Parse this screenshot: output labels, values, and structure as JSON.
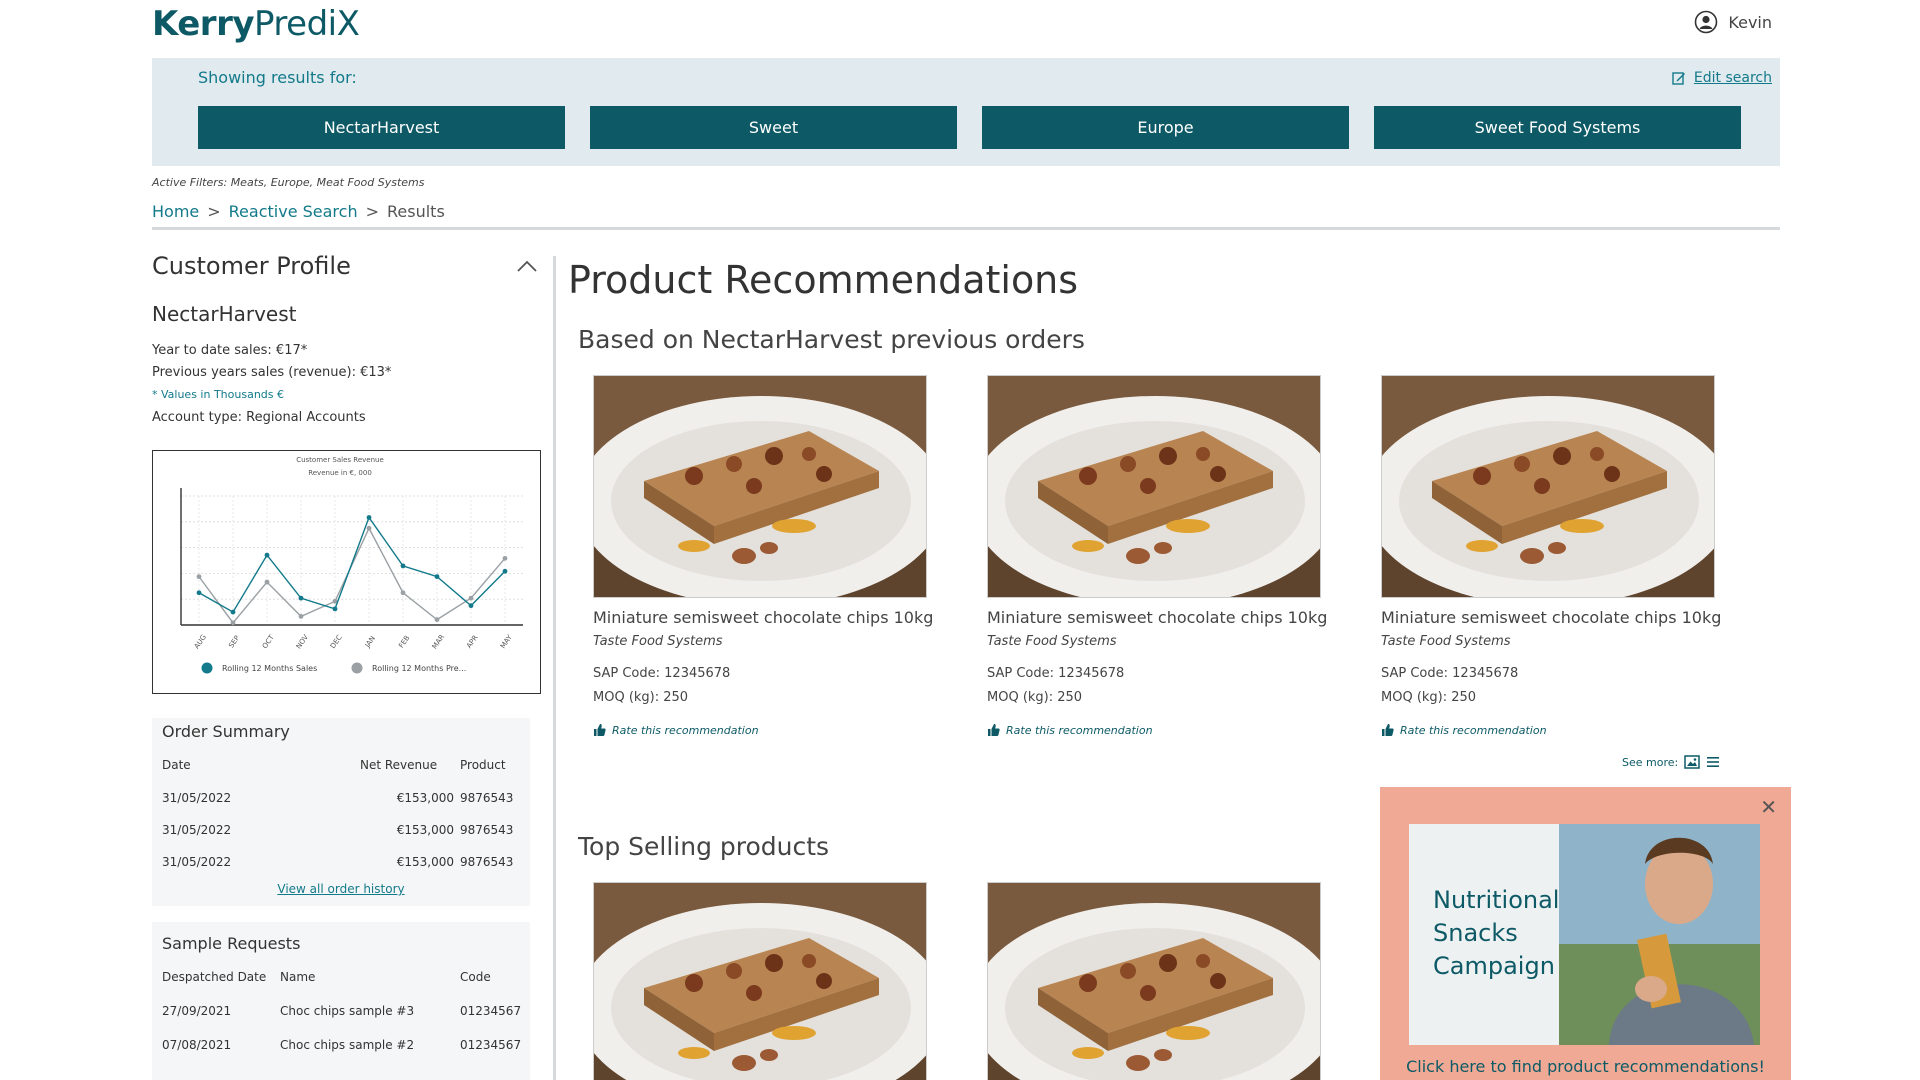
{
  "brand": {
    "bold": "Kerry",
    "light": "PrediX"
  },
  "user": {
    "name": "Kevin"
  },
  "search": {
    "showing_label": "Showing results for:",
    "edit_label": "Edit search",
    "chips": [
      "NectarHarvest",
      "Sweet",
      "Europe",
      "Sweet Food Systems"
    ]
  },
  "filters": "Active Filters: Meats, Europe, Meat Food Systems",
  "breadcrumb": {
    "home": "Home",
    "sep": ">",
    "search": "Reactive Search",
    "current": "Results"
  },
  "profile": {
    "title": "Customer Profile",
    "name": "NectarHarvest",
    "ytd": "Year to date sales: €17*",
    "prev": "Previous years sales (revenue): €13*",
    "note": "* Values in Thousands €",
    "account": "Account type: Regional Accounts"
  },
  "chart_data": {
    "type": "line",
    "title": "Customer Sales Revenue",
    "subtitle": "Revenue in €, 000",
    "categories": [
      "AUG",
      "SEP",
      "OCT",
      "NOV",
      "DEC",
      "JAN",
      "FEB",
      "MAR",
      "APR",
      "MAY"
    ],
    "series": [
      {
        "name": "Rolling 12 Months Sales",
        "color": "#127a8a",
        "values": [
          3.0,
          1.2,
          6.5,
          2.5,
          1.5,
          10.0,
          5.5,
          4.5,
          1.8,
          5.0
        ]
      },
      {
        "name": "Rolling 12 Months Pre...",
        "color": "#9aa0a4",
        "values": [
          4.5,
          0.2,
          4.0,
          0.8,
          2.2,
          9.0,
          3.0,
          0.5,
          2.5,
          6.2
        ]
      }
    ],
    "ylim": [
      0,
      12
    ],
    "grid": true,
    "legend": "bottom"
  },
  "orders": {
    "title": "Order Summary",
    "headers": [
      "Date",
      "Net Revenue",
      "Product"
    ],
    "rows": [
      [
        "31/05/2022",
        "€153,000",
        "9876543"
      ],
      [
        "31/05/2022",
        "€153,000",
        "9876543"
      ],
      [
        "31/05/2022",
        "€153,000",
        "9876543"
      ]
    ],
    "view_all": "View all order history"
  },
  "samples": {
    "title": "Sample Requests",
    "headers": [
      "Despatched Date",
      "Name",
      "Code"
    ],
    "rows": [
      [
        "27/09/2021",
        "Choc chips sample #3",
        "01234567"
      ],
      [
        "07/08/2021",
        "Choc chips sample #2",
        "01234567"
      ]
    ]
  },
  "main": {
    "title": "Product Recommendations",
    "based_on": "Based on NectarHarvest previous orders",
    "top_selling": "Top Selling products",
    "see_more": "See more:"
  },
  "products": [
    {
      "name": "Miniature semisweet chocolate chips 10kg",
      "supplier": "Taste Food Systems",
      "sap": "SAP Code: 12345678",
      "moq": "MOQ (kg): 250",
      "rate": "Rate this recommendation"
    },
    {
      "name": "Miniature semisweet chocolate chips 10kg",
      "supplier": "Taste Food Systems",
      "sap": "SAP Code: 12345678",
      "moq": "MOQ (kg): 250",
      "rate": "Rate this recommendation"
    },
    {
      "name": "Miniature semisweet chocolate chips 10kg",
      "supplier": "Taste Food Systems",
      "sap": "SAP Code: 12345678",
      "moq": "MOQ (kg): 250",
      "rate": "Rate this recommendation"
    }
  ],
  "promo": {
    "line1": "Nutritional",
    "line2": "Snacks",
    "line3": "Campaign",
    "link": "Click here to find product recommendations!"
  }
}
